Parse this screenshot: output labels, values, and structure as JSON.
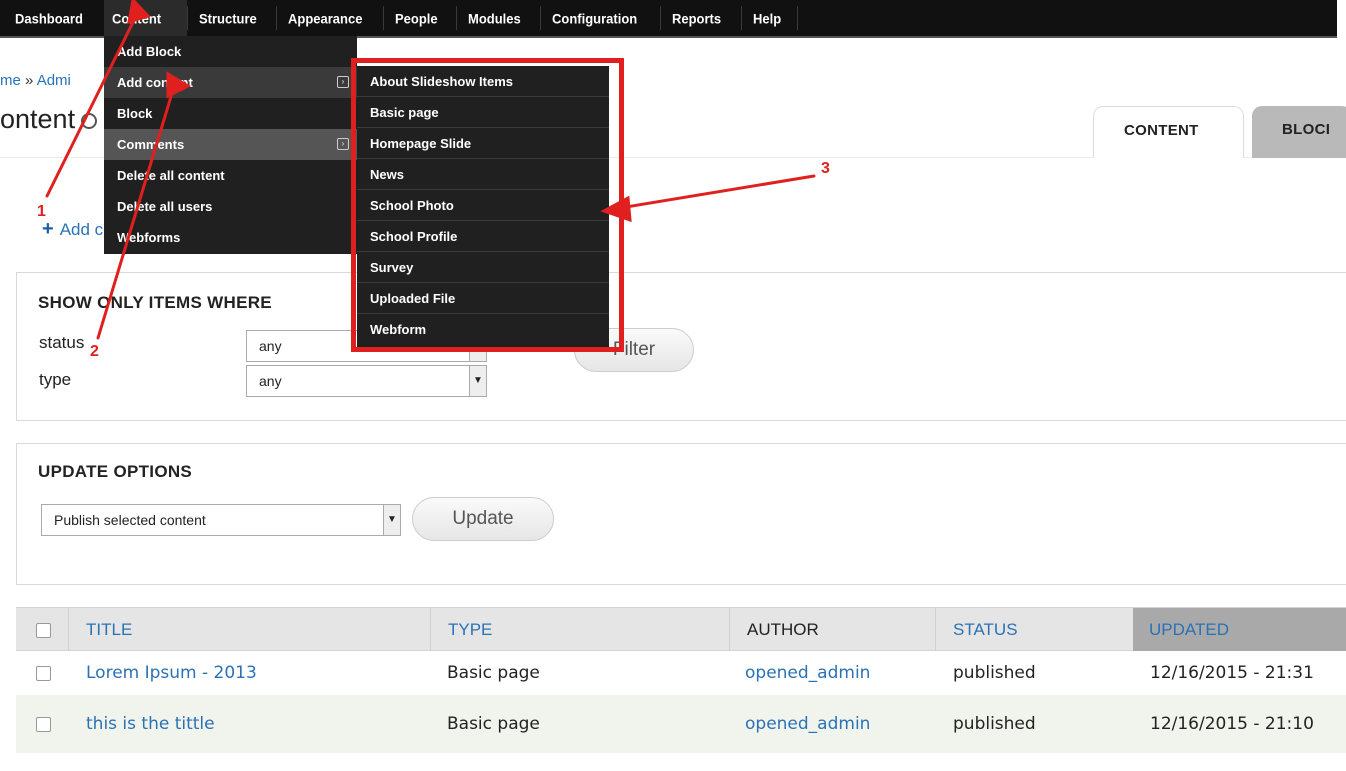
{
  "toolbar": {
    "items": [
      "Dashboard",
      "Content",
      "Structure",
      "Appearance",
      "People",
      "Modules",
      "Configuration",
      "Reports",
      "Help"
    ],
    "active": "Content"
  },
  "breadcrumb": {
    "home": "me",
    "separator": "»",
    "admin": "Admi"
  },
  "page_title": "ontent",
  "tabs": {
    "content": "CONTENT",
    "blocks": "BLOCI"
  },
  "add_content_link": "Add content",
  "menu_content": {
    "items": [
      "Add Block",
      "Add content",
      "Block",
      "Comments",
      "Delete all content",
      "Delete all users",
      "Webforms"
    ]
  },
  "menu_add_content": {
    "items": [
      "About Slideshow Items",
      "Basic page",
      "Homepage Slide",
      "News",
      "School Photo",
      "School Profile",
      "Survey",
      "Uploaded File",
      "Webform"
    ]
  },
  "filter": {
    "legend": "SHOW ONLY ITEMS WHERE",
    "status_label": "status",
    "status_value": "any",
    "type_label": "type",
    "type_value": "any",
    "button": "Filter"
  },
  "update": {
    "legend": "UPDATE OPTIONS",
    "select_value": "Publish selected content",
    "button": "Update"
  },
  "table": {
    "headers": {
      "title": "TITLE",
      "type": "TYPE",
      "author": "AUTHOR",
      "status": "STATUS",
      "updated": "UPDATED"
    },
    "rows": [
      {
        "title": "Lorem Ipsum - 2013",
        "type": "Basic page",
        "author": "opened_admin",
        "status": "published",
        "updated": "12/16/2015 - 21:31"
      },
      {
        "title": "this is the tittle",
        "type": "Basic page",
        "author": "opened_admin",
        "status": "published",
        "updated": "12/16/2015 - 21:10"
      }
    ]
  },
  "annotations": {
    "a1": "1",
    "a2": "2",
    "a3": "3"
  },
  "colors": {
    "toolbar": "#111111",
    "menu": "#202020",
    "link": "#2a72b5",
    "annotation": "#e0201f",
    "row_alt": "#f1f4ec"
  }
}
